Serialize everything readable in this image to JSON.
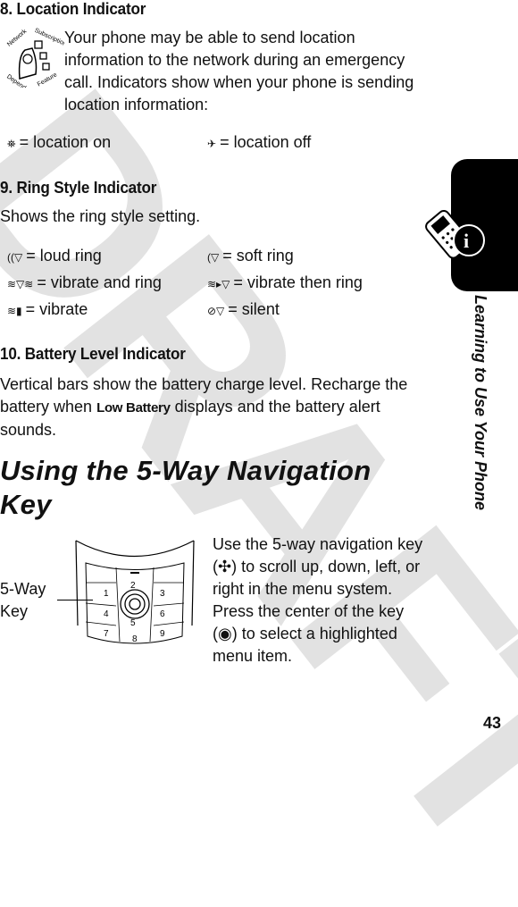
{
  "watermark": "DRAFT",
  "badge": {
    "text": "Network / Subscription Dependent Feature",
    "icon": "network-dependent-feature-icon"
  },
  "section8": {
    "heading": "8. Location Indicator",
    "body": "Your phone may be able to send location information to the network during an emergency call. Indicators show when your phone is sending location information:",
    "items": [
      {
        "icon": "location-on-icon",
        "label": "= location on"
      },
      {
        "icon": "location-off-icon",
        "label": "= location off"
      }
    ]
  },
  "section9": {
    "heading": "9. Ring Style Indicator",
    "body": "Shows the ring style setting.",
    "items": [
      {
        "icon": "loud-ring-icon",
        "label": "= loud ring"
      },
      {
        "icon": "soft-ring-icon",
        "label": "= soft ring"
      },
      {
        "icon": "vibrate-and-ring-icon",
        "label": "= vibrate and ring"
      },
      {
        "icon": "vibrate-then-ring-icon",
        "label": "= vibrate then ring"
      },
      {
        "icon": "vibrate-icon",
        "label": "= vibrate"
      },
      {
        "icon": "silent-icon",
        "label": "= silent"
      }
    ]
  },
  "section10": {
    "heading": "10. Battery Level Indicator",
    "body_before": "Vertical bars show the battery charge level. Recharge the battery when",
    "display_text": "Low Battery",
    "body_after": "displays and the battery alert sounds."
  },
  "nav": {
    "heading": "Using the 5-Way Navigation Key",
    "body1": "Use the 5-way navigation key (",
    "body2": ") to scroll up, down, left, or right in the menu system. Press the center of the key (",
    "body3": ") to select a highlighted menu item.",
    "callout": "5-Way Key",
    "keys": [
      "1",
      "2",
      "3",
      "4",
      "5",
      "6",
      "7",
      "8",
      "9"
    ]
  },
  "side_tab": {
    "title": "Learning to Use Your Phone",
    "icon": "phone-info-icon"
  },
  "page_number": "43"
}
